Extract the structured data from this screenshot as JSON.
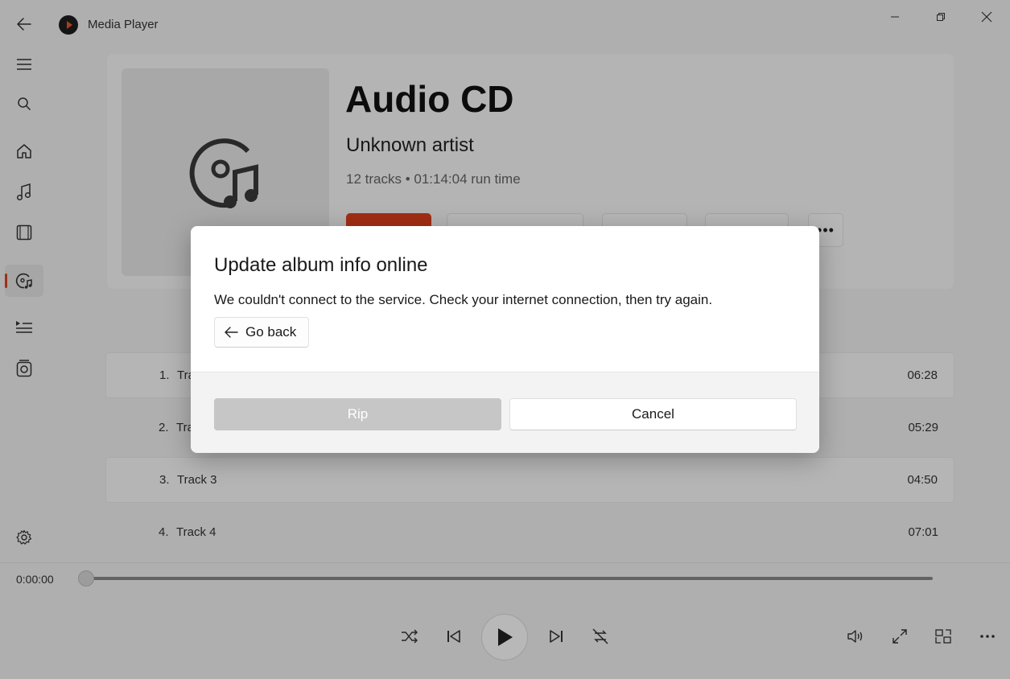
{
  "window": {
    "app_title": "Media Player",
    "controls": [
      "minimize-icon",
      "restore-icon",
      "close-icon"
    ]
  },
  "nav": {
    "items": [
      {
        "name": "menu",
        "icon": "hamburger-icon"
      },
      {
        "name": "search",
        "icon": "search-icon"
      },
      {
        "name": "home",
        "icon": "home-icon"
      },
      {
        "name": "music",
        "icon": "music-note-icon"
      },
      {
        "name": "video",
        "icon": "film-icon"
      },
      {
        "name": "audio-cd",
        "icon": "cd-music-icon",
        "active": true
      },
      {
        "name": "play-queue",
        "icon": "queue-icon"
      },
      {
        "name": "playlists",
        "icon": "playlist-icon"
      },
      {
        "name": "settings",
        "icon": "gear-icon"
      }
    ]
  },
  "album": {
    "title": "Audio CD",
    "artist": "Unknown artist",
    "meta": "12 tracks • 01:14:04 run time",
    "accent": "#e0401c"
  },
  "tracks": [
    {
      "num": "1.",
      "name": "Tra",
      "duration": "06:28"
    },
    {
      "num": "2.",
      "name": "Tra",
      "duration": "05:29"
    },
    {
      "num": "3.",
      "name": "Track 3",
      "duration": "04:50"
    },
    {
      "num": "4.",
      "name": "Track 4",
      "duration": "07:01"
    }
  ],
  "player": {
    "current_time": "0:00:00",
    "progress": 0
  },
  "dialog": {
    "title": "Update album info online",
    "message": "We couldn't connect to the service. Check your internet connection, then try again.",
    "go_back_label": "Go back",
    "rip_label": "Rip",
    "cancel_label": "Cancel"
  }
}
